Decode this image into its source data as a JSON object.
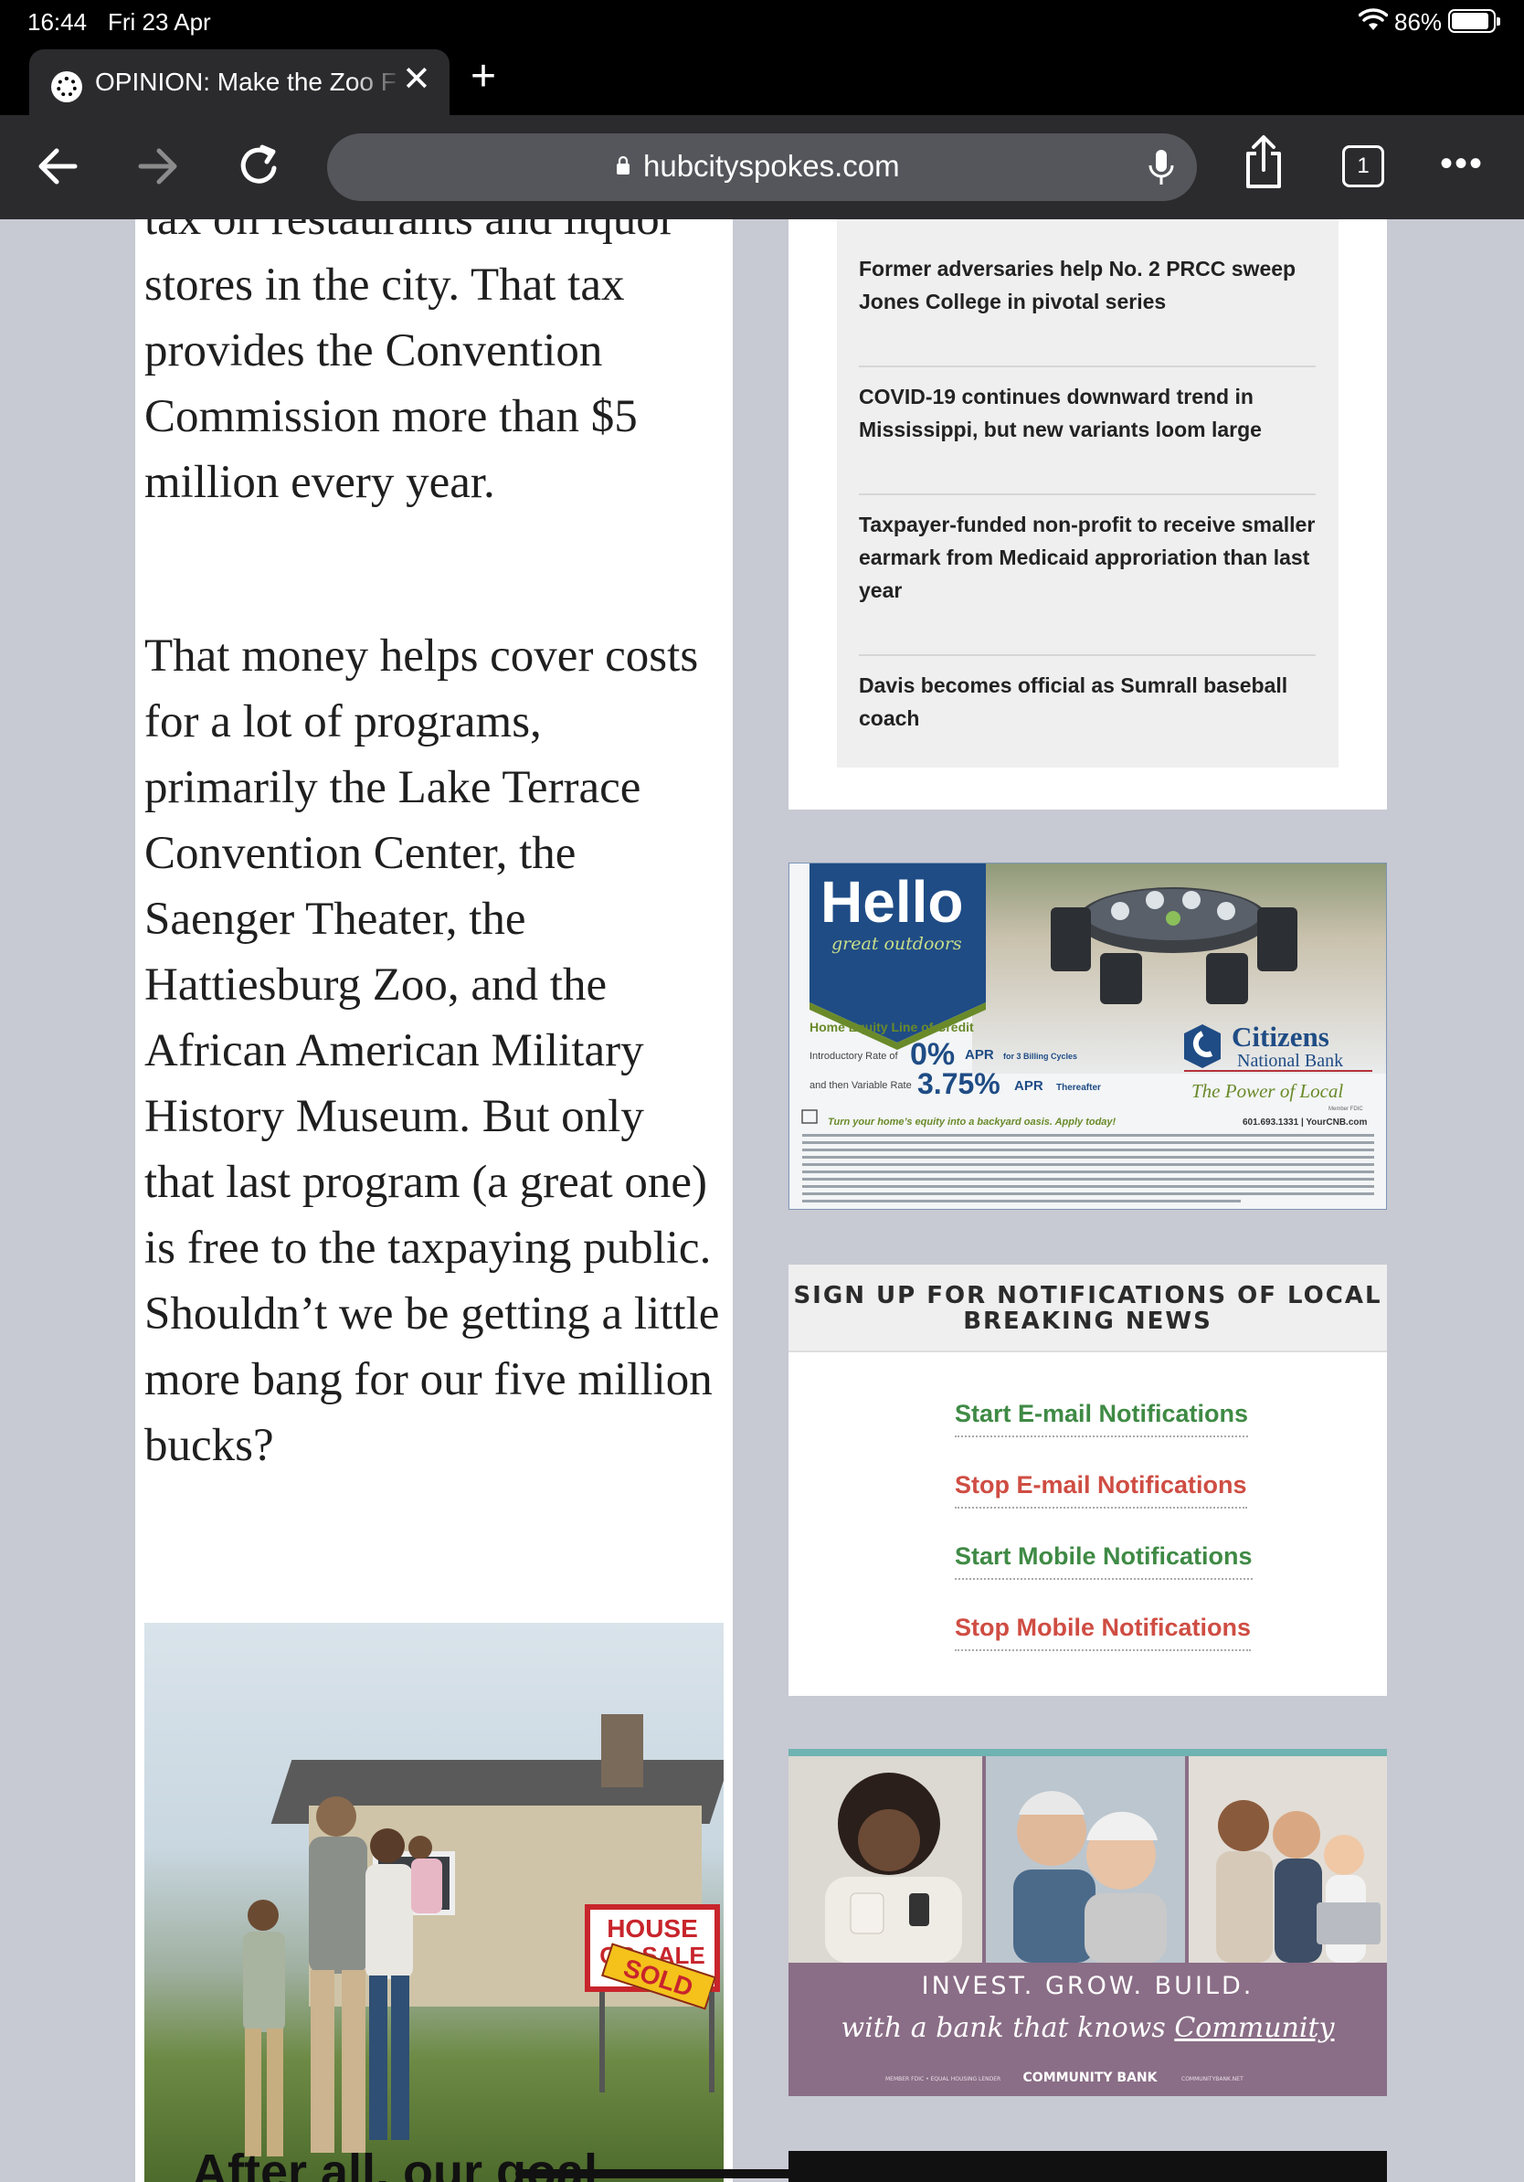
{
  "status_bar": {
    "time": "16:44",
    "date": "Fri 23 Apr",
    "battery": "86%"
  },
  "tab": {
    "title": "OPINION: Make the Zoo F"
  },
  "toolbar": {
    "url": "hubcityspokes.com",
    "tab_count": "1"
  },
  "article": {
    "paragraph_1": "tax on restaurants and liquor stores in the city. That tax provides the Convention Commission more than $5 million every year.",
    "paragraph_2": "That money helps cover costs for a lot of programs, primarily the Lake Terrace Convention Center, the Saenger Theater, the Hattiesburg Zoo, and the African American Military History Museum. But only that last program (a great one) is free to the taxpaying public. Shouldn’t we be getting a little more bang for our five million bucks?"
  },
  "house_ad": {
    "sign_top": "HOUSE",
    "sign_bottom": "OR SALE",
    "sold": "SOLD",
    "headline": "After all, our goal"
  },
  "trending": {
    "items": [
      "Former adversaries help No. 2 PRCC sweep Jones College in pivotal series",
      "COVID-19 continues downward trend in Mississippi, but new variants loom large",
      "Taxpayer-funded non-profit to receive smaller earmark from Medicaid approriation than last year",
      "Davis becomes official as Sumrall baseball coach"
    ]
  },
  "cnb_ad": {
    "hello": "Hello",
    "great_outdoors": "great outdoors",
    "heloc": "Home Equity Line of Credit",
    "intro_label": "Introductory Rate of",
    "intro_rate": "0%",
    "apr": "APR",
    "intro_term": "for 3 Billing Cycles",
    "then_label": "and then Variable Rate",
    "var_rate": "3.75%",
    "thereafter": "Thereafter",
    "bank_1": "Citizens",
    "bank_2": "National Bank",
    "slogan": "The Power of Local",
    "member": "Member FDIC",
    "cta": "Turn your home’s equity into a backyard oasis. Apply today!",
    "phone_web": "601.693.1331  |  YourCNB.com",
    "colors": {
      "navy": "#1f4c85",
      "green": "#6a8a2a",
      "red": "#b5323a"
    }
  },
  "signup": {
    "heading_1": "SIGN UP FOR NOTIFICATIONS OF LOCAL",
    "heading_2": "BREAKING NEWS",
    "links": {
      "start_email": "Start E-mail Notifications",
      "stop_email": "Stop E-mail Notifications",
      "start_mobile": "Start Mobile Notifications",
      "stop_mobile": "Stop Mobile Notifications"
    },
    "colors": {
      "start": "#3f8a45",
      "stop": "#cf4d43"
    }
  },
  "bank_ad": {
    "tagline": "INVEST. GROW. BUILD.",
    "script_1": "with a bank that knows",
    "script_2": "Community",
    "bank": "COMMUNITY BANK",
    "fine_left": "MEMBER FDIC  •  EQUAL HOUSING LENDER",
    "fine_right": "COMMUNITYBANK.NET"
  },
  "icons": [
    "wifi-icon",
    "battery-icon",
    "site-favicon",
    "close-icon",
    "plus-icon",
    "back-arrow-icon",
    "forward-arrow-icon",
    "reload-icon",
    "lock-icon",
    "microphone-icon",
    "share-icon",
    "tabs-icon",
    "more-icon"
  ]
}
